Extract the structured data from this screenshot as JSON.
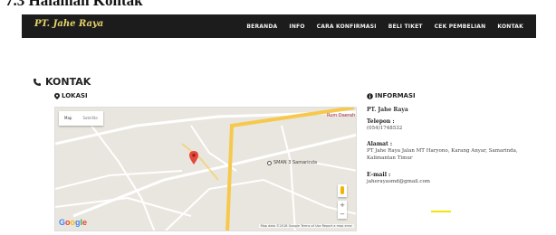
{
  "top_strip": {
    "text": "7.3 Halaman Kontak"
  },
  "navbar": {
    "brand": "PT. Jahe Raya",
    "items": [
      "BERANDA",
      "INFO",
      "CARA KONFIRMASI",
      "BELI TIKET",
      "CEK PEMBELIAN",
      "KONTAK"
    ]
  },
  "section": {
    "title": "KONTAK",
    "location_title": "LOKASI",
    "info_title": "INFORMASI"
  },
  "map": {
    "type_map": "Map",
    "type_satellite": "Satellite",
    "school_label": "SMAN 3 Samarinda",
    "area_label": "Rum Daerah",
    "footer": "Map data ©2018 Google   Terms of Use   Report a map error",
    "zoom_in": "+",
    "zoom_out": "−"
  },
  "info": {
    "company": "PT. Jahe Raya",
    "phone_label": "Telepon :",
    "phone_value": "(054)1748532",
    "address_label": "Alamat :",
    "address_value": "PT Jahe Raya Jalan MT Haryono, Karang Anyar, Samarinda, Kalimantan Timur",
    "email_label": "E-mail :",
    "email_value": "jaherayasmd@gmail.com"
  },
  "colors": {
    "navbar": "#1c1c1c",
    "brand": "#e6d36a",
    "accent": "#f4e20a",
    "pin": "#e5483b"
  }
}
